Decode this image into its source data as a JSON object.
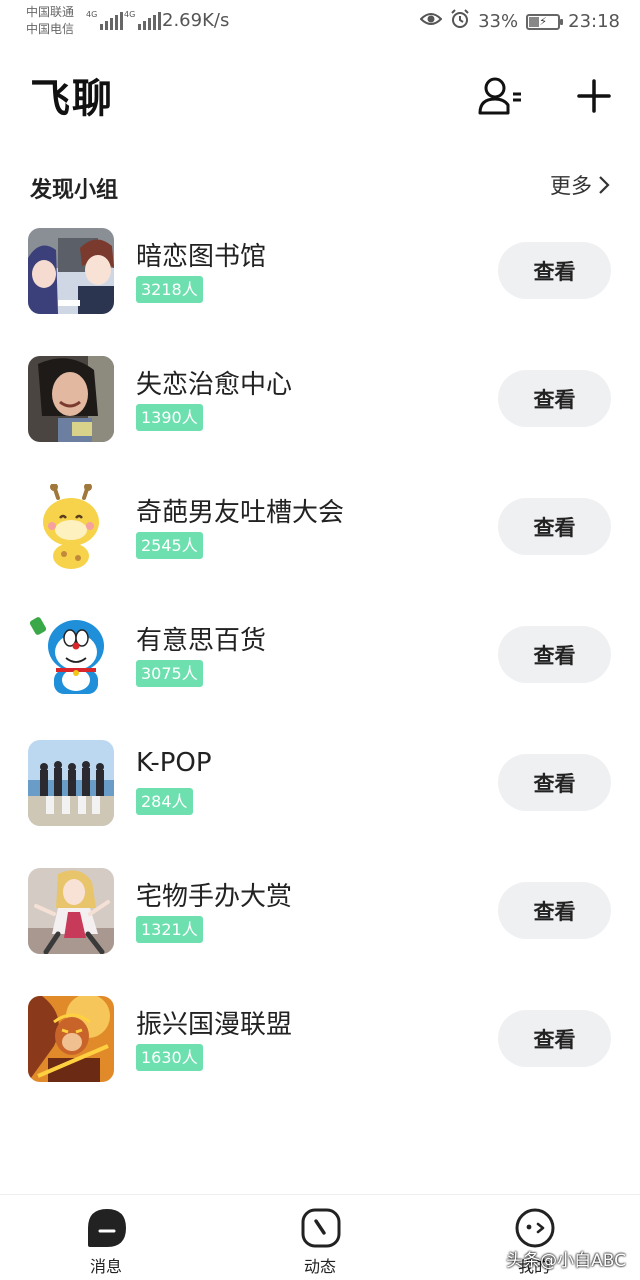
{
  "status_bar": {
    "carrier_1": "中国联通",
    "carrier_2": "中国电信",
    "net_label_1": "4G",
    "net_label_2": "4G",
    "net_speed": "2.69K/s",
    "battery": "33%",
    "time": "23:18"
  },
  "header": {
    "title": "飞聊",
    "contacts_icon": "user-list-icon",
    "add_icon": "plus-icon"
  },
  "section": {
    "title": "发现小组",
    "more_label": "更多"
  },
  "groups": [
    {
      "name": "暗恋图书馆",
      "members": "3218人",
      "action": "查看",
      "thumb_icon": "anime-couple-thumbnail"
    },
    {
      "name": "失恋治愈中心",
      "members": "1390人",
      "action": "查看",
      "thumb_icon": "crying-girl-thumbnail"
    },
    {
      "name": "奇葩男友吐槽大会",
      "members": "2545人",
      "action": "查看",
      "thumb_icon": "giraffe-sticker-thumbnail"
    },
    {
      "name": "有意思百货",
      "members": "3075人",
      "action": "查看",
      "thumb_icon": "doraemon-thumbnail"
    },
    {
      "name": "K-POP",
      "members": "284人",
      "action": "查看",
      "thumb_icon": "kpop-group-photo-thumbnail"
    },
    {
      "name": "宅物手办大赏",
      "members": "1321人",
      "action": "查看",
      "thumb_icon": "figure-thumbnail"
    },
    {
      "name": "振兴国漫联盟",
      "members": "1630人",
      "action": "查看",
      "thumb_icon": "monkey-king-thumbnail"
    }
  ],
  "bottom_nav": [
    {
      "label": "消息",
      "icon": "chat-bubble-icon"
    },
    {
      "label": "动态",
      "icon": "clock-icon"
    },
    {
      "label": "我的",
      "icon": "face-icon"
    }
  ],
  "watermark": "头条@小白ABC",
  "colors": {
    "member_badge": "#6ee0b0",
    "button_bg": "#eff0f2",
    "text": "#222222"
  }
}
